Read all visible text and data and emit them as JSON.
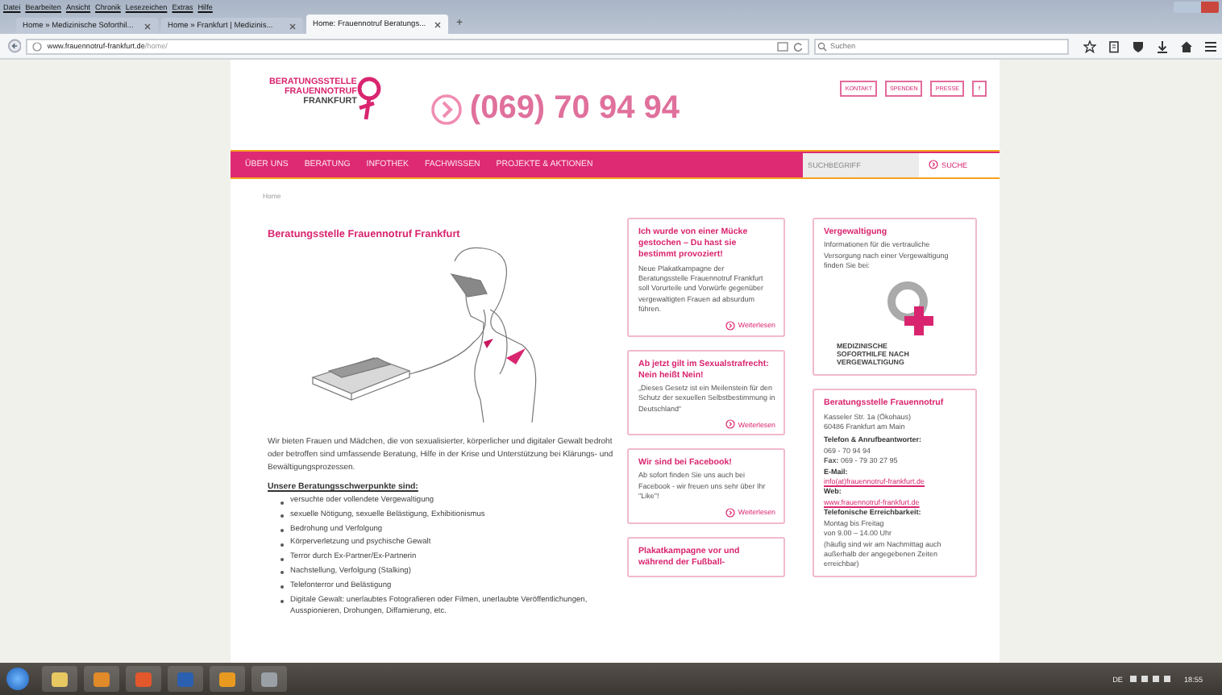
{
  "browser": {
    "menu": [
      "Datei",
      "Bearbeiten",
      "Ansicht",
      "Chronik",
      "Lesezeichen",
      "Extras",
      "Hilfe"
    ],
    "tabs": [
      {
        "label": "Home » Medizinische Soforthil...",
        "selected": false
      },
      {
        "label": "Home » Frankfurt | Medizinis...",
        "selected": false
      },
      {
        "label": "Home: Frauennotruf Beratungs...",
        "selected": true
      }
    ],
    "new_tab": "+",
    "address": {
      "host": "www.frauennotruf-frankfurt.de",
      "path": "/home/"
    },
    "search_placeholder": "Suchen"
  },
  "site": {
    "logo": [
      "BERATUNGSSTELLE",
      "FRAUENNOTRUF",
      "FRANKFURT"
    ],
    "phone": "(069) 70 94 94",
    "top_links": [
      "KONTAKT",
      "SPENDEN",
      "PRESSE"
    ],
    "facebook": "f",
    "nav": [
      "ÜBER UNS",
      "BERATUNG",
      "INFOTHEK",
      "FACHWISSEN",
      "PROJEKTE & AKTIONEN"
    ],
    "search": {
      "placeholder": "SUCHBEGRIFF",
      "button": "SUCHE"
    },
    "breadcrumb": "Home"
  },
  "main": {
    "title": "Beratungsstelle Frauennotruf Frankfurt",
    "intro": "Wir bieten Frauen und Mädchen, die von sexualisierter, körperlicher und digitaler Gewalt bedroht oder betroffen sind umfassende Beratung, Hilfe in der Krise und Unterstützung bei Klärungs- und Bewältigungsprozessen.",
    "list_heading": "Unsere Beratungsschwerpunkte sind:",
    "list": [
      "versuchte oder vollendete Vergewaltigung",
      "sexuelle Nötigung, sexuelle Belästigung, Exhibitionismus",
      "Bedrohung und Verfolgung",
      "Körperverletzung und psychische Gewalt",
      "Terror durch Ex-Partner/Ex-Partnerin",
      "Nachstellung, Verfolgung (Stalking)",
      "Telefonterror und Belästigung",
      "Digitale Gewalt: unerlaubtes Fotografieren oder Filmen, unerlaubte Veröffentlichungen, Ausspionieren, Drohungen, Diffamierung, etc."
    ]
  },
  "news": [
    {
      "title": "Ich wurde von einer Mücke gestochen – Du hast sie bestimmt provoziert!",
      "text": "Neue Plakatkampagne der Beratungsstelle Frauennotruf Frankfurt soll Vorurteile und Vorwürfe gegenüber vergewaltigten Frauen ad absurdum führen.",
      "link": "Weiterlesen"
    },
    {
      "title": "Ab jetzt gilt im Sexualstrafrecht: Nein heißt Nein!",
      "text": "„Dieses Gesetz ist ein Meilenstein für den Schutz der sexuellen Selbstbestimmung in Deutschland“",
      "link": "Weiterlesen"
    },
    {
      "title": "Wir sind bei Facebook!",
      "text": "Ab sofort finden Sie uns auch bei Facebook - wir freuen uns sehr über Ihr \"Like\"!",
      "link": "Weiterlesen"
    },
    {
      "title": "Plakatkampagne vor und während der Fußball-"
    }
  ],
  "sidebar": {
    "care_card": {
      "title": "Vergewaltigung",
      "text": "Informationen für die vertrauliche Versorgung nach einer Vergewaltigung finden Sie bei:",
      "logo_text": [
        "MEDIZINISCHE",
        "SOFORTHILFE NACH",
        "VERGEWALTIGUNG"
      ]
    },
    "contact_card": {
      "title": "Beratungsstelle Frauennotruf",
      "lines": [
        {
          "kind": "text",
          "text": "Kasseler Str. 1a (Ökohaus)"
        },
        {
          "kind": "text",
          "text": "60486 Frankfurt am Main"
        },
        {
          "kind": "label",
          "text": "Telefon & Anrufbeantworter:"
        },
        {
          "kind": "text",
          "text": "069 - 70 94 94"
        },
        {
          "kind": "text",
          "text": "**Fax:** 069 - 79 30 27 95"
        },
        {
          "kind": "label",
          "text": "E-Mail:"
        },
        {
          "kind": "link",
          "text": "info(at)frauennotruf-frankfurt.de"
        },
        {
          "kind": "label",
          "text": "Web:"
        },
        {
          "kind": "link",
          "text": "www.frauennotruf-frankfurt.de"
        },
        {
          "kind": "label",
          "text": "Telefonische Erreichbarkeit:"
        },
        {
          "kind": "text",
          "text": "Montag bis Freitag"
        },
        {
          "kind": "text",
          "text": "von 9.00 – 14.00 Uhr"
        },
        {
          "kind": "text",
          "text": "(häufig sind wir am Nachmittag auch außerhalb der angegebenen Zeiten erreichbar)"
        }
      ]
    }
  },
  "taskbar": {
    "language": "DE",
    "time": "18:55"
  }
}
